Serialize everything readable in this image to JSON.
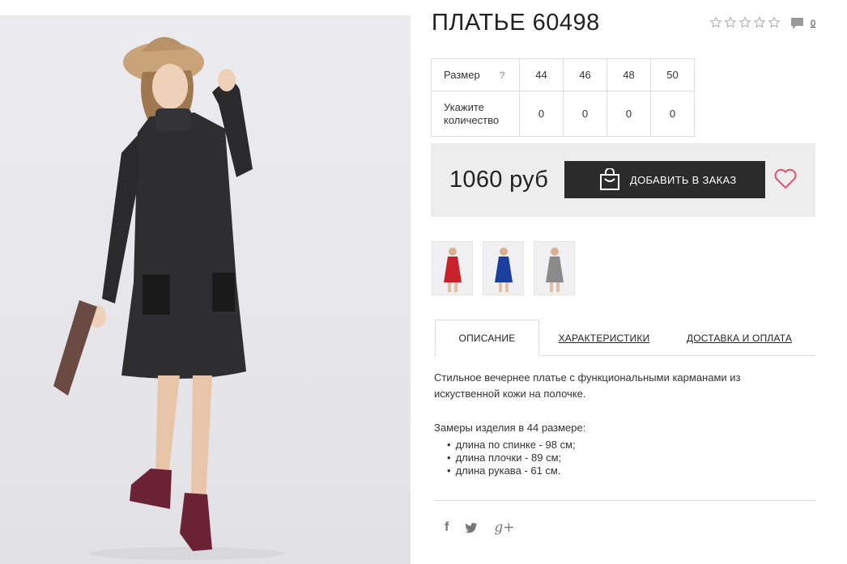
{
  "product": {
    "title": "ПЛАТЬЕ 60498",
    "rating_stars": 0,
    "rating_max": 5,
    "comments_count": "0"
  },
  "sizes": {
    "size_label": "Размер",
    "help_mark": "?",
    "qty_label": "Укажите количество",
    "items": [
      {
        "size": "44",
        "qty": "0"
      },
      {
        "size": "46",
        "qty": "0"
      },
      {
        "size": "48",
        "qty": "0"
      },
      {
        "size": "50",
        "qty": "0"
      }
    ]
  },
  "buy": {
    "price": "1060 руб",
    "add_label": "ДОБАВИТЬ В ЗАКАЗ"
  },
  "thumbs": [
    {
      "color": "#c8232c",
      "name": "red"
    },
    {
      "color": "#1b3f9e",
      "name": "blue"
    },
    {
      "color": "#8a8a8a",
      "name": "grey"
    }
  ],
  "tabs": {
    "description": "ОПИСАНИЕ",
    "characteristics": "ХАРАКТЕРИСТИКИ",
    "delivery": "ДОСТАВКА И ОПЛАТА"
  },
  "description": {
    "text": "Стильное вечернее платье с функциональными карманами из искуственной кожи на полочке.",
    "measurements_title": "Замеры изделия в 44 размере:",
    "measurements": [
      "длина по спинке - 98 см;",
      "длина плочки - 89 см;",
      "длина рукава - 61 см."
    ]
  },
  "social": {
    "facebook": "f",
    "twitter": "twitter-icon",
    "googleplus": "g+"
  },
  "colors": {
    "button_bg": "#2b2b2b",
    "heart": "#e0526f",
    "buybox_bg": "#ededed"
  }
}
